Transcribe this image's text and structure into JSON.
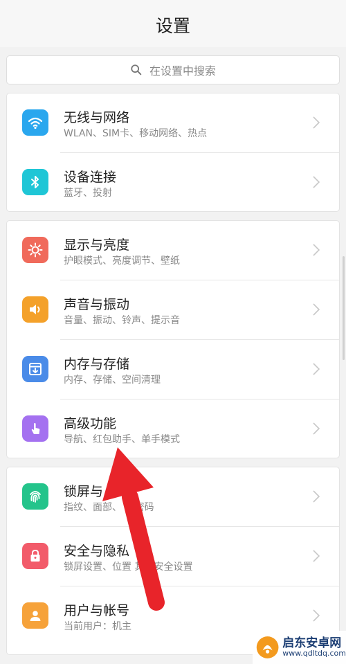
{
  "header": {
    "title": "设置"
  },
  "search": {
    "placeholder": "在设置中搜索",
    "icon": "search-icon"
  },
  "groups": [
    {
      "items": [
        {
          "label": "无线与网络",
          "sub": "WLAN、SIM卡、移动网络、热点",
          "icon": "wifi-icon",
          "color": "#2aa7ee"
        },
        {
          "label": "设备连接",
          "sub": "蓝牙、投射",
          "icon": "bluetooth-icon",
          "color": "#1fc6d6"
        }
      ]
    },
    {
      "items": [
        {
          "label": "显示与亮度",
          "sub": "护眼模式、亮度调节、壁纸",
          "icon": "brightness-icon",
          "color": "#f06a5b"
        },
        {
          "label": "声音与振动",
          "sub": "音量、振动、铃声、提示音",
          "icon": "speaker-icon",
          "color": "#f4a12a"
        },
        {
          "label": "内存与存储",
          "sub": "内存、存储、空间清理",
          "icon": "storage-icon",
          "color": "#4a8be8"
        },
        {
          "label": "高级功能",
          "sub": "导航、红包助手、单手模式",
          "icon": "hand-icon",
          "color": "#a471f0"
        }
      ]
    },
    {
      "items": [
        {
          "label": "锁屏与",
          "sub": "指纹、面部、 屏密码",
          "icon": "fingerprint-icon",
          "color": "#24c48b"
        },
        {
          "label": "安全与隐私",
          "sub": "锁屏设置、位置 其他安全设置",
          "icon": "lock-icon",
          "color": "#f25b6a"
        },
        {
          "label": "用户与帐号",
          "sub": "当前用户：机主",
          "icon": "user-icon",
          "color": "#f6a23a"
        }
      ]
    }
  ],
  "watermark": {
    "title": "启东安卓网",
    "url": "www.qdltdq.com"
  },
  "colors": {
    "annotation_arrow": "#e8242a"
  }
}
